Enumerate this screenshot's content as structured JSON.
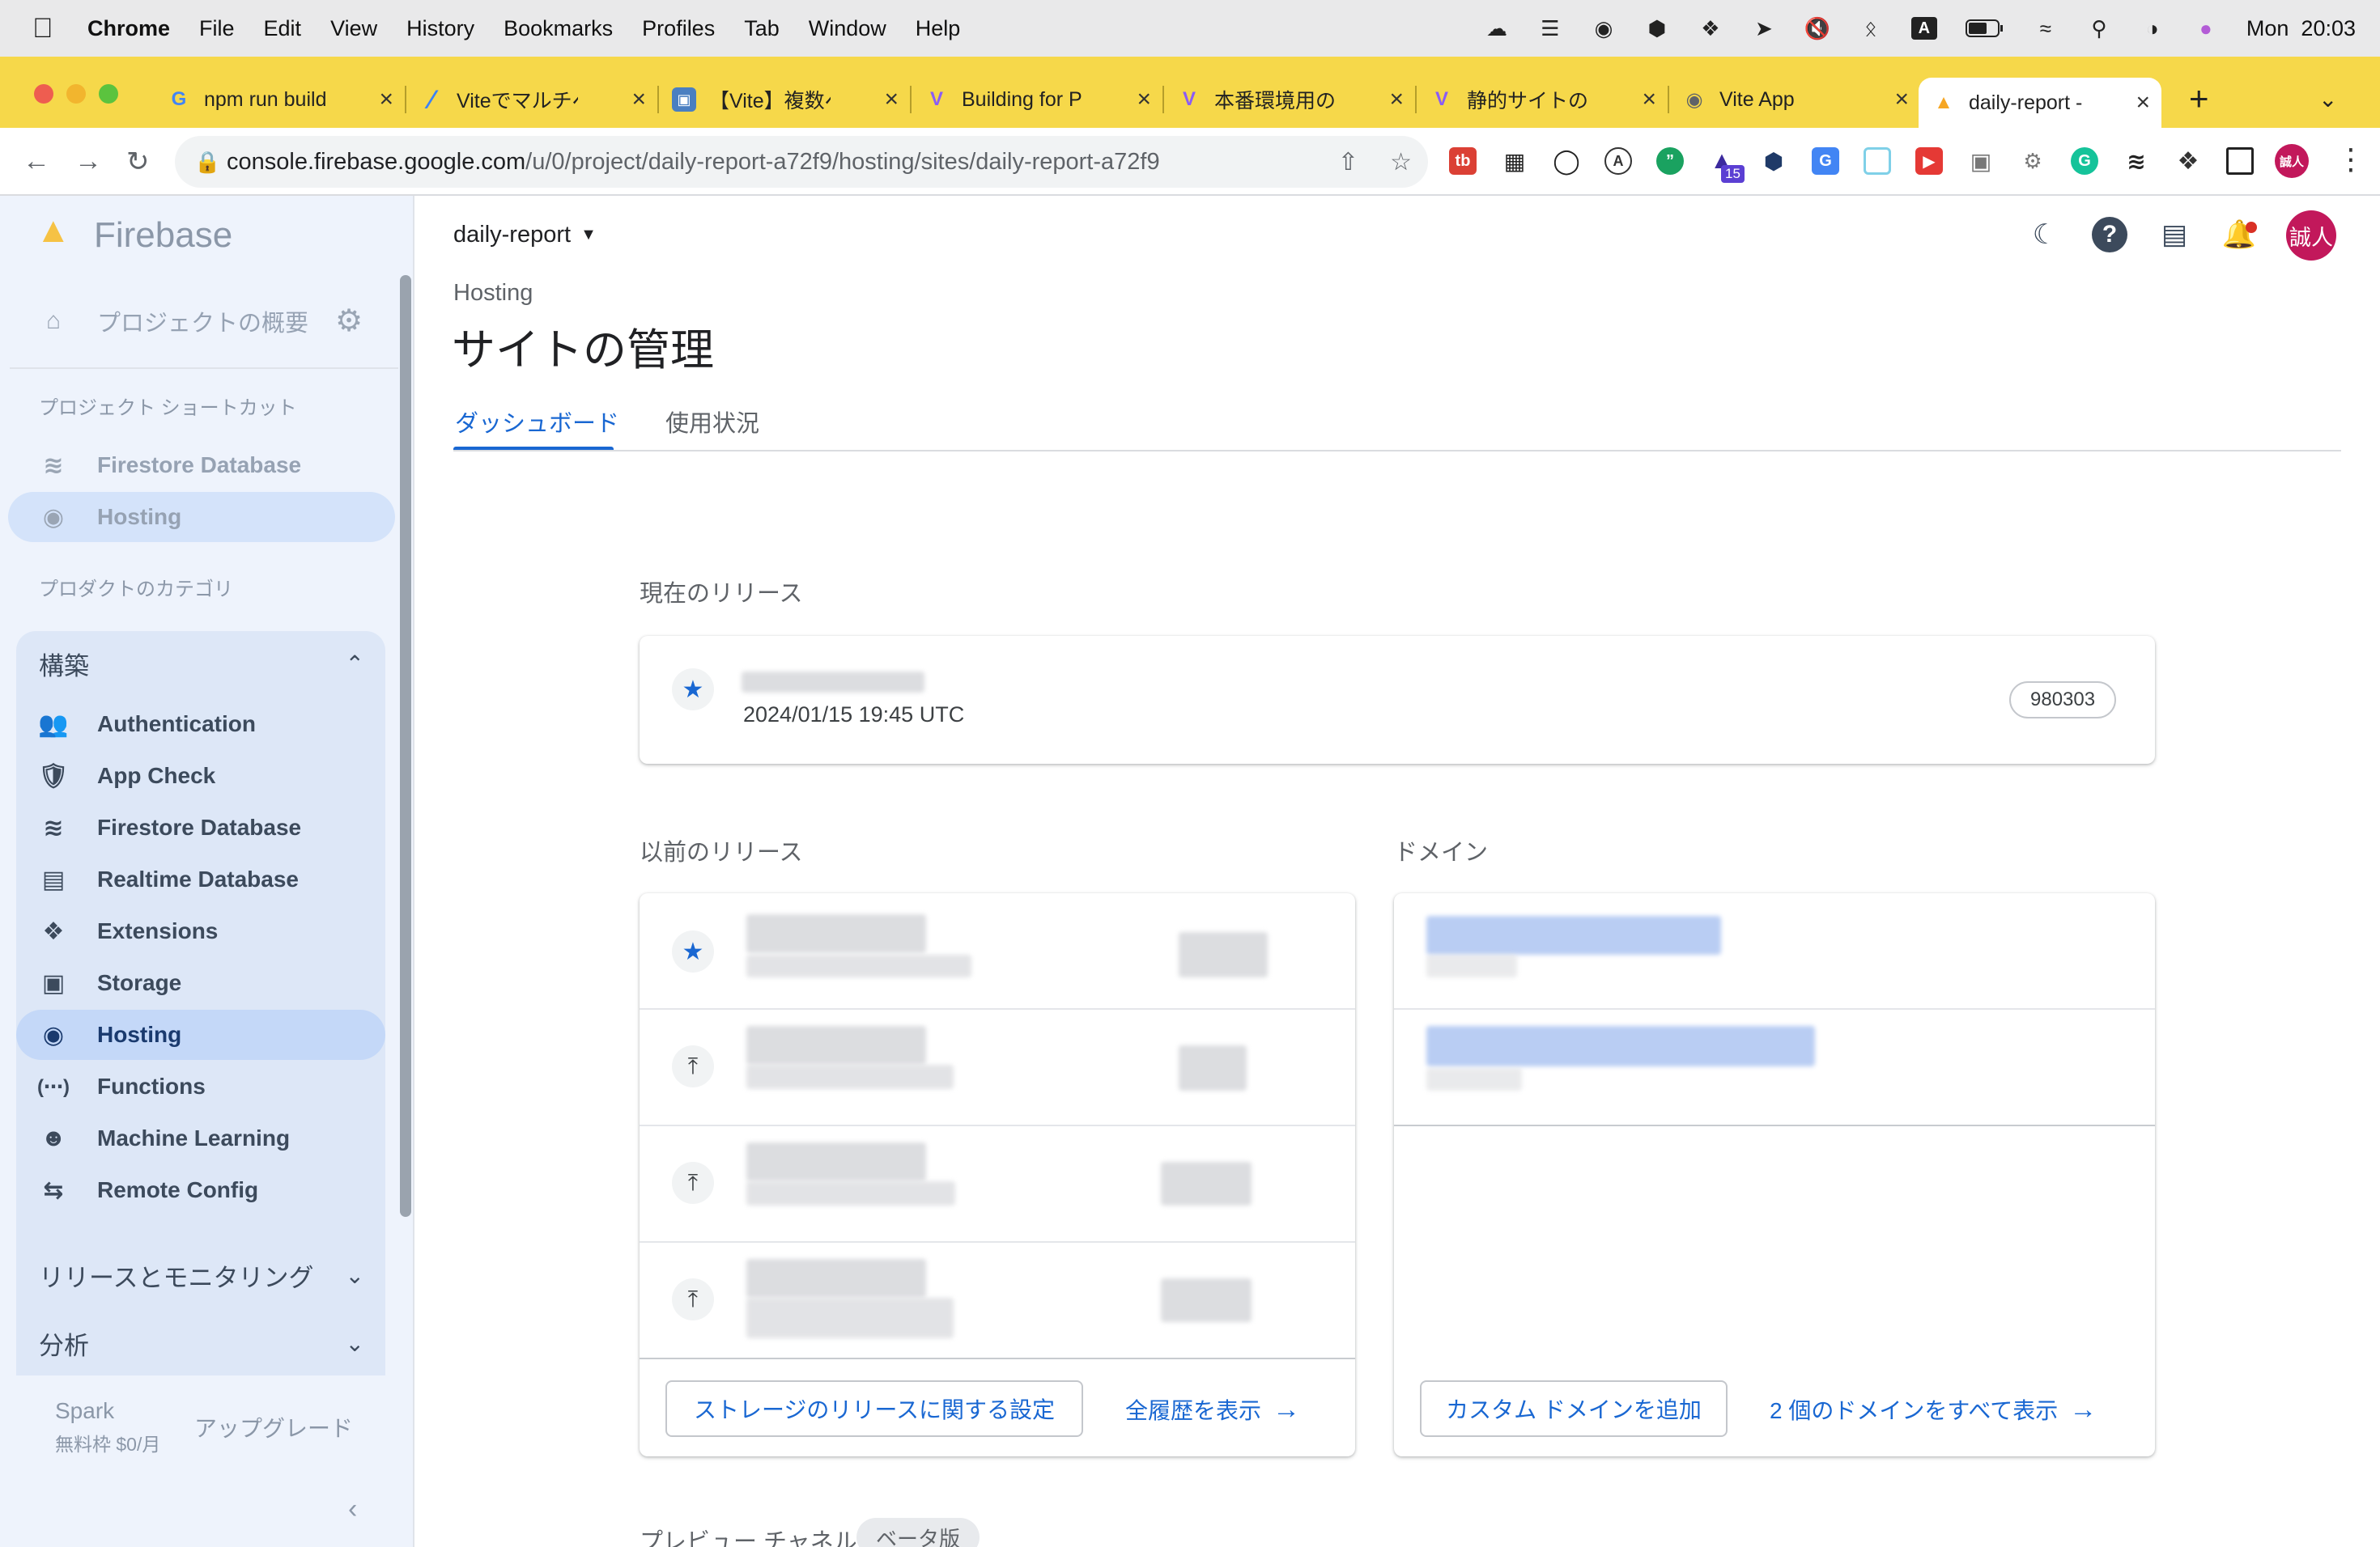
{
  "menubar": {
    "app": "Chrome",
    "items": [
      "File",
      "Edit",
      "View",
      "History",
      "Bookmarks",
      "Profiles",
      "Tab",
      "Window",
      "Help"
    ],
    "clock": "Mon  20:03"
  },
  "tabs": [
    {
      "label": "npm run build, v",
      "favicon": "google-icon"
    },
    {
      "label": "Viteでマルチペー",
      "favicon": "slash-icon"
    },
    {
      "label": "【Vite】複数ペー",
      "favicon": "image-icon"
    },
    {
      "label": "Building for Pro",
      "favicon": "vite-icon"
    },
    {
      "label": "本番環境用のビル",
      "favicon": "vite-icon"
    },
    {
      "label": "静的サイトのデプ",
      "favicon": "vite-icon"
    },
    {
      "label": "Vite App",
      "favicon": "globe-icon"
    },
    {
      "label": "daily-report - ",
      "favicon": "firebase-icon",
      "active": true
    }
  ],
  "address": {
    "host": "console.firebase.google.com",
    "path": "/u/0/project/daily-report-a72f9/hosting/sites/daily-report-a72f9"
  },
  "extensions": {
    "badge": "15",
    "profile_initials": "誠人"
  },
  "sidebar": {
    "brand": "Firebase",
    "overview": "プロジェクトの概要",
    "shortcuts_heading": "プロジェクト ショートカット",
    "shortcuts": [
      "Firestore Database",
      "Hosting"
    ],
    "categories_heading": "プロダクトのカテゴリ",
    "build_section": "構築",
    "build_items": [
      "Authentication",
      "App Check",
      "Firestore Database",
      "Realtime Database",
      "Extensions",
      "Storage",
      "Hosting",
      "Functions",
      "Machine Learning",
      "Remote Config"
    ],
    "release_section": "リリースとモニタリング",
    "analytics_section": "分析",
    "plan_name": "Spark",
    "plan_price": "無料枠 $0/月",
    "upgrade": "アップグレード"
  },
  "header": {
    "project": "daily-report",
    "avatar": "誠人"
  },
  "page": {
    "breadcrumb": "Hosting",
    "title": "サイトの管理",
    "tabs": [
      "ダッシュボード",
      "使用状況"
    ]
  },
  "current_release": {
    "heading": "現在のリリース",
    "timestamp": "2024/01/15 19:45 UTC",
    "version": "980303"
  },
  "previous_releases": {
    "heading": "以前のリリース",
    "storage_settings": "ストレージのリリースに関する設定",
    "view_history": "全履歴を表示"
  },
  "domains": {
    "heading": "ドメイン",
    "add_custom": "カスタム ドメインを追加",
    "view_all": "2 個のドメインをすべて表示"
  },
  "preview": {
    "heading": "プレビュー チャネル",
    "badge": "ベータ版"
  },
  "colors": {
    "accent": "#1967d2",
    "tabstrip": "#f6d84a",
    "sidebar_bg": "#eef3fc",
    "sidebar_active": "#c4d8f8",
    "avatar": "#c2185b"
  }
}
